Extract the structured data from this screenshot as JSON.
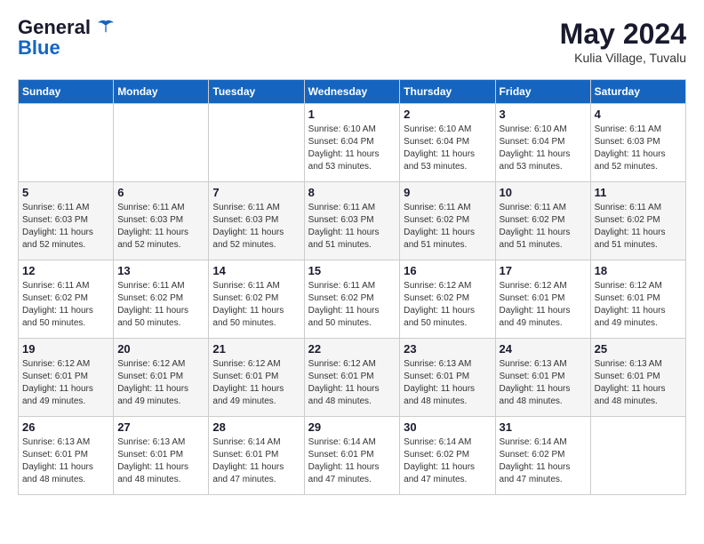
{
  "header": {
    "logo_general": "General",
    "logo_blue": "Blue",
    "month": "May 2024",
    "location": "Kulia Village, Tuvalu"
  },
  "days_of_week": [
    "Sunday",
    "Monday",
    "Tuesday",
    "Wednesday",
    "Thursday",
    "Friday",
    "Saturday"
  ],
  "weeks": [
    {
      "days": [
        {
          "date": "",
          "info": ""
        },
        {
          "date": "",
          "info": ""
        },
        {
          "date": "",
          "info": ""
        },
        {
          "date": "1",
          "info": "Sunrise: 6:10 AM\nSunset: 6:04 PM\nDaylight: 11 hours and 53 minutes."
        },
        {
          "date": "2",
          "info": "Sunrise: 6:10 AM\nSunset: 6:04 PM\nDaylight: 11 hours and 53 minutes."
        },
        {
          "date": "3",
          "info": "Sunrise: 6:10 AM\nSunset: 6:04 PM\nDaylight: 11 hours and 53 minutes."
        },
        {
          "date": "4",
          "info": "Sunrise: 6:11 AM\nSunset: 6:03 PM\nDaylight: 11 hours and 52 minutes."
        }
      ]
    },
    {
      "days": [
        {
          "date": "5",
          "info": "Sunrise: 6:11 AM\nSunset: 6:03 PM\nDaylight: 11 hours and 52 minutes."
        },
        {
          "date": "6",
          "info": "Sunrise: 6:11 AM\nSunset: 6:03 PM\nDaylight: 11 hours and 52 minutes."
        },
        {
          "date": "7",
          "info": "Sunrise: 6:11 AM\nSunset: 6:03 PM\nDaylight: 11 hours and 52 minutes."
        },
        {
          "date": "8",
          "info": "Sunrise: 6:11 AM\nSunset: 6:03 PM\nDaylight: 11 hours and 51 minutes."
        },
        {
          "date": "9",
          "info": "Sunrise: 6:11 AM\nSunset: 6:02 PM\nDaylight: 11 hours and 51 minutes."
        },
        {
          "date": "10",
          "info": "Sunrise: 6:11 AM\nSunset: 6:02 PM\nDaylight: 11 hours and 51 minutes."
        },
        {
          "date": "11",
          "info": "Sunrise: 6:11 AM\nSunset: 6:02 PM\nDaylight: 11 hours and 51 minutes."
        }
      ]
    },
    {
      "days": [
        {
          "date": "12",
          "info": "Sunrise: 6:11 AM\nSunset: 6:02 PM\nDaylight: 11 hours and 50 minutes."
        },
        {
          "date": "13",
          "info": "Sunrise: 6:11 AM\nSunset: 6:02 PM\nDaylight: 11 hours and 50 minutes."
        },
        {
          "date": "14",
          "info": "Sunrise: 6:11 AM\nSunset: 6:02 PM\nDaylight: 11 hours and 50 minutes."
        },
        {
          "date": "15",
          "info": "Sunrise: 6:11 AM\nSunset: 6:02 PM\nDaylight: 11 hours and 50 minutes."
        },
        {
          "date": "16",
          "info": "Sunrise: 6:12 AM\nSunset: 6:02 PM\nDaylight: 11 hours and 50 minutes."
        },
        {
          "date": "17",
          "info": "Sunrise: 6:12 AM\nSunset: 6:01 PM\nDaylight: 11 hours and 49 minutes."
        },
        {
          "date": "18",
          "info": "Sunrise: 6:12 AM\nSunset: 6:01 PM\nDaylight: 11 hours and 49 minutes."
        }
      ]
    },
    {
      "days": [
        {
          "date": "19",
          "info": "Sunrise: 6:12 AM\nSunset: 6:01 PM\nDaylight: 11 hours and 49 minutes."
        },
        {
          "date": "20",
          "info": "Sunrise: 6:12 AM\nSunset: 6:01 PM\nDaylight: 11 hours and 49 minutes."
        },
        {
          "date": "21",
          "info": "Sunrise: 6:12 AM\nSunset: 6:01 PM\nDaylight: 11 hours and 49 minutes."
        },
        {
          "date": "22",
          "info": "Sunrise: 6:12 AM\nSunset: 6:01 PM\nDaylight: 11 hours and 48 minutes."
        },
        {
          "date": "23",
          "info": "Sunrise: 6:13 AM\nSunset: 6:01 PM\nDaylight: 11 hours and 48 minutes."
        },
        {
          "date": "24",
          "info": "Sunrise: 6:13 AM\nSunset: 6:01 PM\nDaylight: 11 hours and 48 minutes."
        },
        {
          "date": "25",
          "info": "Sunrise: 6:13 AM\nSunset: 6:01 PM\nDaylight: 11 hours and 48 minutes."
        }
      ]
    },
    {
      "days": [
        {
          "date": "26",
          "info": "Sunrise: 6:13 AM\nSunset: 6:01 PM\nDaylight: 11 hours and 48 minutes."
        },
        {
          "date": "27",
          "info": "Sunrise: 6:13 AM\nSunset: 6:01 PM\nDaylight: 11 hours and 48 minutes."
        },
        {
          "date": "28",
          "info": "Sunrise: 6:14 AM\nSunset: 6:01 PM\nDaylight: 11 hours and 47 minutes."
        },
        {
          "date": "29",
          "info": "Sunrise: 6:14 AM\nSunset: 6:01 PM\nDaylight: 11 hours and 47 minutes."
        },
        {
          "date": "30",
          "info": "Sunrise: 6:14 AM\nSunset: 6:02 PM\nDaylight: 11 hours and 47 minutes."
        },
        {
          "date": "31",
          "info": "Sunrise: 6:14 AM\nSunset: 6:02 PM\nDaylight: 11 hours and 47 minutes."
        },
        {
          "date": "",
          "info": ""
        }
      ]
    }
  ]
}
